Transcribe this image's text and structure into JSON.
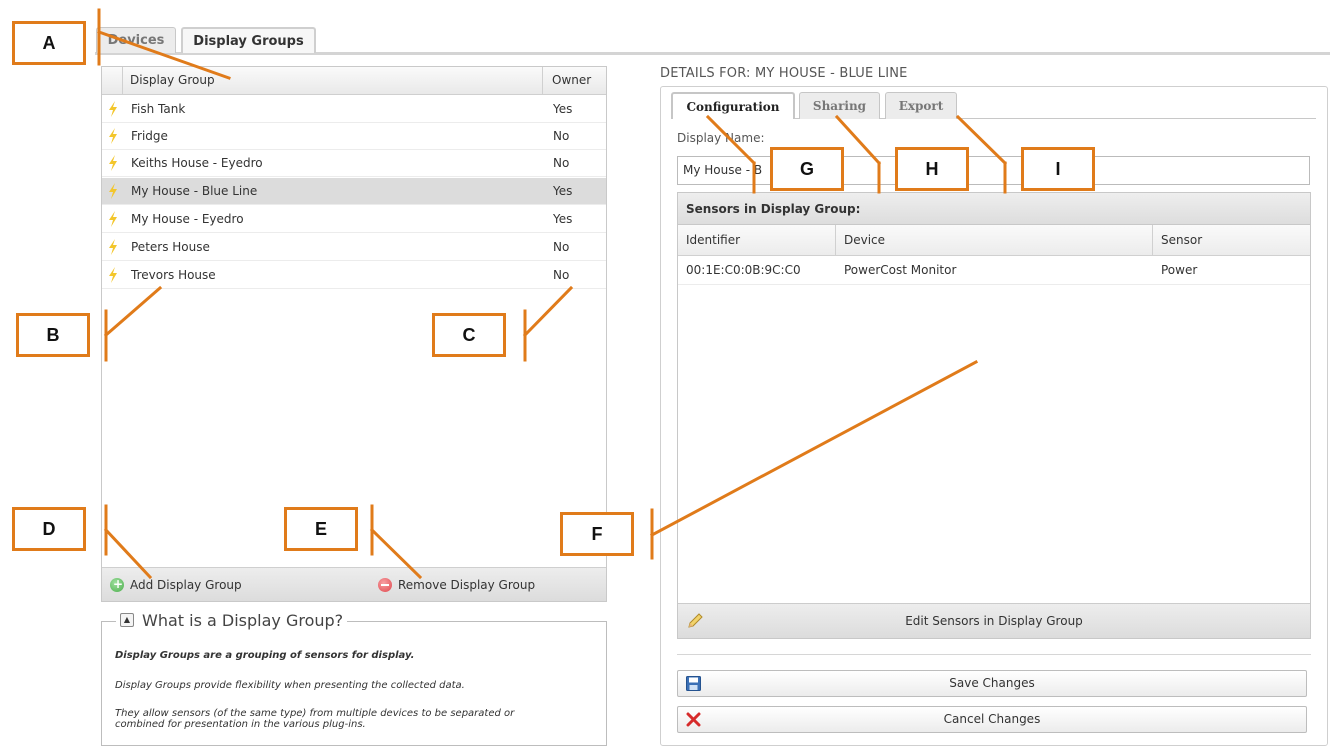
{
  "top_tabs": [
    "Devices",
    "Display Groups"
  ],
  "groups_grid": {
    "columns": [
      "Display Group",
      "Owner"
    ],
    "rows": [
      {
        "name": "Fish Tank",
        "owner": "Yes"
      },
      {
        "name": "Fridge",
        "owner": "No"
      },
      {
        "name": "Keiths House - Eyedro",
        "owner": "No"
      },
      {
        "name": "My House - Blue Line",
        "owner": "Yes",
        "selected": true
      },
      {
        "name": "My House - Eyedro",
        "owner": "Yes"
      },
      {
        "name": "Peters House",
        "owner": "No"
      },
      {
        "name": "Trevors House",
        "owner": "No"
      }
    ],
    "add_label": "Add Display Group",
    "remove_label": "Remove Display Group"
  },
  "info": {
    "title": "What is a Display Group?",
    "line1": "Display Groups are a grouping of sensors for display.",
    "line2": "Display Groups provide flexibility when presenting the collected data.",
    "line3": "They allow sensors (of the same type) from multiple devices to be separated or combined for presentation in the various plug-ins."
  },
  "details": {
    "title": "DETAILS FOR: MY HOUSE - BLUE LINE",
    "tabs": [
      "Configuration",
      "Sharing",
      "Export"
    ],
    "display_name_label": "Display Name:",
    "display_name_value": "My House - B",
    "sensors_title": "Sensors in Display Group:",
    "sensor_columns": [
      "Identifier",
      "Device",
      "Sensor"
    ],
    "sensor_rows": [
      {
        "identifier": "00:1E:C0:0B:9C:C0",
        "device": "PowerCost Monitor",
        "sensor": "Power"
      }
    ],
    "edit_sensors_label": "Edit Sensors in Display Group",
    "save_label": "Save Changes",
    "cancel_label": "Cancel Changes"
  },
  "annotations": [
    "A",
    "B",
    "C",
    "D",
    "E",
    "F",
    "G",
    "H",
    "I"
  ],
  "colors": {
    "annotation": "#e07b1a",
    "selected_row": "#dcdcdc",
    "bolt": "#f3c62b",
    "add_icon": "#5cb85c",
    "remove_icon": "#e8545a",
    "cancel_icon": "#d62b2b",
    "save_icon": "#3a6fb5"
  }
}
